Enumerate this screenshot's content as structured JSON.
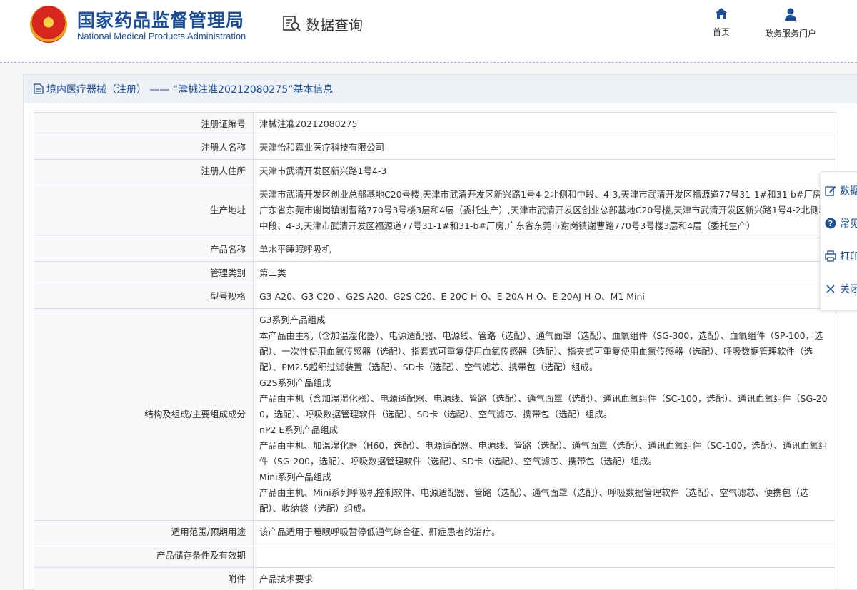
{
  "header": {
    "brand_cn": "国家药品监督管理局",
    "brand_en": "National Medical Products Administration",
    "query_label": "数据查询",
    "nav": [
      {
        "label": "首页",
        "icon": "home-icon"
      },
      {
        "label": "政务服务门户",
        "icon": "user-icon"
      }
    ]
  },
  "panel": {
    "title": "境内医疗器械（注册） —— “津械注准20212080275”基本信息"
  },
  "rows": [
    {
      "key": "注册证编号",
      "value": "津械注准20212080275"
    },
    {
      "key": "注册人名称",
      "value": "天津怡和嘉业医疗科技有限公司"
    },
    {
      "key": "注册人住所",
      "value": "天津市武清开发区新兴路1号4-3"
    },
    {
      "key": "生产地址",
      "value": "天津市武清开发区创业总部基地C20号楼,天津市武清开发区新兴路1号4-2北侧和中段、4-3,天津市武清开发区福源道77号31-1#和31-b#厂房,广东省东莞市谢岗镇谢曹路770号3号楼3层和4层（委托生产）,天津市武清开发区创业总部基地C20号楼,天津市武清开发区新兴路1号4-2北侧和中段、4-3,天津市武清开发区福源道77号31-1#和31-b#厂房,广东省东莞市谢岗镇谢曹路770号3号楼3层和4层（委托生产）"
    },
    {
      "key": "产品名称",
      "value": "单水平睡眠呼吸机"
    },
    {
      "key": "管理类别",
      "value": "第二类"
    },
    {
      "key": "型号规格",
      "value": "G3 A20、G3 C20 、G2S A20、G2S C20、E-20C-H-O、E-20A-H-O、E-20AJ-H-O、M1 Mini"
    },
    {
      "key": "结构及组成/主要组成成分",
      "lines": [
        "G3系列产品组成",
        "本产品由主机（含加温湿化器）、电源适配器、电源线、管路（选配）、通气面罩（选配）、血氧组件（SG-300，选配）、血氧组件（SP-100，选配）、一次性使用血氧传感器（选配）、指套式可重复使用血氧传感器（选配）、指夹式可重复使用血氧传感器（选配）、呼吸数据管理软件（选配）、PM2.5超细过滤装置（选配）、SD卡（选配）、空气滤芯、携带包（选配）组成。",
        "G2S系列产品组成",
        "产品由主机（含加温湿化器）、电源适配器、电源线、管路（选配）、通气面罩（选配）、通讯血氧组件（SC-100，选配）、通讯血氧组件（SG-200，选配）、呼吸数据管理软件（选配）、SD卡（选配）、空气滤芯、携带包（选配）组成。",
        "nP2 E系列产品组成",
        "产品由主机、加温湿化器（H60，选配）、电源适配器、电源线、管路（选配）、通气面罩（选配）、通讯血氧组件（SC-100，选配）、通讯血氧组件（SG-200，选配）、呼吸数据管理软件（选配）、SD卡（选配）、空气滤芯、携带包（选配）组成。",
        "Mini系列产品组成",
        "产品由主机、Mini系列呼吸机控制软件、电源适配器、管路（选配）、通气面罩（选配）、呼吸数据管理软件（选配）、空气滤芯、便携包（选配）、收纳袋（选配）组成。"
      ]
    },
    {
      "key": "适用范围/预期用途",
      "value": "该产品适用于睡眠呼吸暂停低通气综合征、鼾症患者的治疗。"
    },
    {
      "key": "产品储存条件及有效期",
      "value": ""
    },
    {
      "key": "附件",
      "value": "产品技术要求"
    }
  ],
  "tools": [
    {
      "label": "数据纠错",
      "icon": "edit-icon"
    },
    {
      "label": "常见问题",
      "icon": "help-icon"
    },
    {
      "label": "打印",
      "icon": "print-icon"
    },
    {
      "label": "关闭",
      "icon": "close-icon"
    }
  ],
  "colors": {
    "brand": "#1b4f9c",
    "label_bg": "#f7f8fa",
    "border": "#d9dde3"
  }
}
